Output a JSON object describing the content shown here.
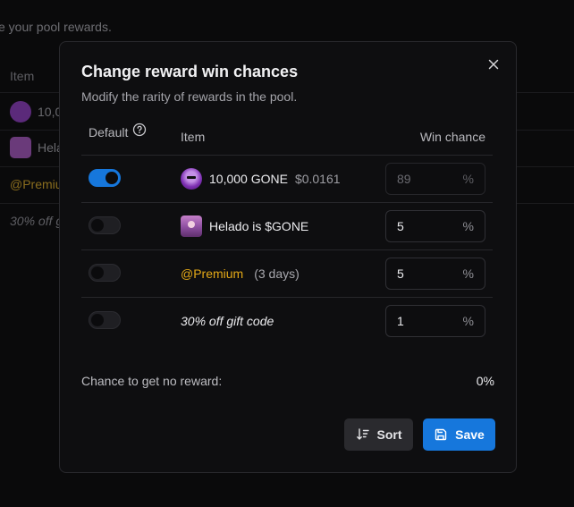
{
  "background": {
    "subtitle": "e your pool rewards.",
    "header_item": "Item",
    "rows": [
      {
        "label": "10,0"
      },
      {
        "label": "Hela"
      },
      {
        "label": "@Premiu"
      },
      {
        "label": "30% off g"
      }
    ]
  },
  "modal": {
    "title": "Change reward win chances",
    "subtitle": "Modify the rarity of rewards in the pool.",
    "close_icon": "close-icon",
    "columns": {
      "default": "Default",
      "item": "Item",
      "win_chance": "Win chance"
    },
    "rows": [
      {
        "default_on": true,
        "item_name": "10,000 GONE",
        "item_price": "$0.0161",
        "win_chance": "89",
        "editable": false,
        "percent": "%"
      },
      {
        "default_on": false,
        "item_name": "Helado is $GONE",
        "win_chance": "5",
        "editable": true,
        "percent": "%"
      },
      {
        "default_on": false,
        "item_name": "@Premium",
        "item_detail": "(3 days)",
        "win_chance": "5",
        "editable": true,
        "percent": "%"
      },
      {
        "default_on": false,
        "item_name": "30% off gift code",
        "win_chance": "1",
        "editable": true,
        "percent": "%"
      }
    ],
    "no_reward": {
      "label": "Chance to get no reward:",
      "value": "0%"
    },
    "buttons": {
      "sort": "Sort",
      "save": "Save"
    }
  },
  "colors": {
    "accent": "#1677dc",
    "premium": "#e3a817",
    "modal_bg": "#0e0e10",
    "page_bg": "#000000"
  }
}
